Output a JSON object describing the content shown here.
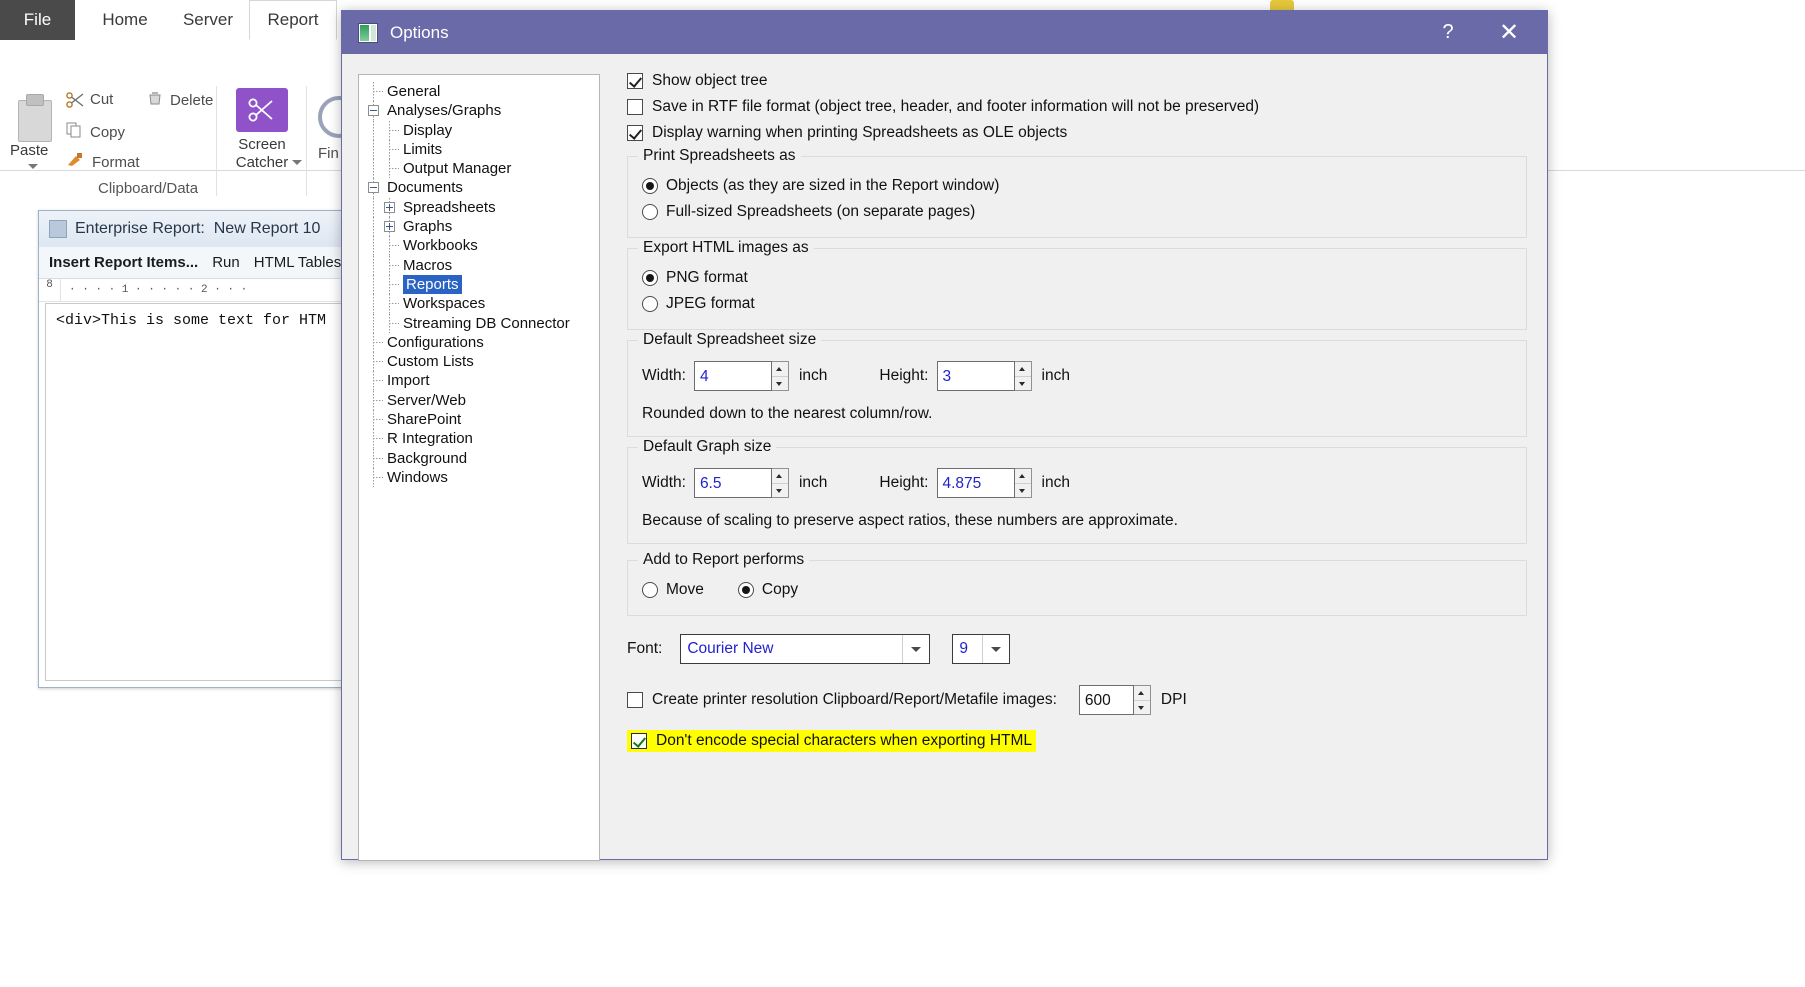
{
  "app": {
    "ribbon": {
      "tabs": [
        {
          "label": "File",
          "active": false
        },
        {
          "label": "Home",
          "active": false
        },
        {
          "label": "Server",
          "active": false
        },
        {
          "label": "Report",
          "active": true
        }
      ],
      "paste_label": "Paste",
      "clipboard_items": [
        "Cut",
        "Copy",
        "Format"
      ],
      "delete_label": "Delete",
      "screen_catcher_label": "Screen\nCatcher",
      "screen_catcher_line1": "Screen",
      "screen_catcher_line2": "Catcher",
      "find_label": "Fin",
      "group_label": "Clipboard/Data"
    },
    "document_window": {
      "title_prefix": "Enterprise Report:",
      "title_name": "New Report 10",
      "toolbar": [
        "Insert Report Items...",
        "Run",
        "HTML Tables"
      ],
      "ruler_marks": "·  ·  ·  ·  1  ·  ·  ·  ·  ·  2  ·  ·  ·",
      "ruler_corner": "8",
      "body_text": "<div>This is some text for HTM"
    }
  },
  "dialog": {
    "title": "Options",
    "icon": "options-window-icon",
    "help_label": "?",
    "close_label": "✕",
    "accent_color": "#6a6aa8",
    "tree": {
      "selected": "Reports",
      "items": [
        {
          "label": "General",
          "depth": 0,
          "expander": "none"
        },
        {
          "label": "Analyses/Graphs",
          "depth": 0,
          "expander": "minus"
        },
        {
          "label": "Display",
          "depth": 1,
          "expander": "none"
        },
        {
          "label": "Limits",
          "depth": 1,
          "expander": "none"
        },
        {
          "label": "Output Manager",
          "depth": 1,
          "expander": "none"
        },
        {
          "label": "Documents",
          "depth": 0,
          "expander": "minus"
        },
        {
          "label": "Spreadsheets",
          "depth": 1,
          "expander": "plus"
        },
        {
          "label": "Graphs",
          "depth": 1,
          "expander": "plus"
        },
        {
          "label": "Workbooks",
          "depth": 1,
          "expander": "none"
        },
        {
          "label": "Macros",
          "depth": 1,
          "expander": "none"
        },
        {
          "label": "Reports",
          "depth": 1,
          "expander": "none"
        },
        {
          "label": "Workspaces",
          "depth": 1,
          "expander": "none"
        },
        {
          "label": "Streaming DB Connector",
          "depth": 1,
          "expander": "none"
        },
        {
          "label": "Configurations",
          "depth": 0,
          "expander": "none"
        },
        {
          "label": "Custom Lists",
          "depth": 0,
          "expander": "none"
        },
        {
          "label": "Import",
          "depth": 0,
          "expander": "none"
        },
        {
          "label": "Server/Web",
          "depth": 0,
          "expander": "none"
        },
        {
          "label": "SharePoint",
          "depth": 0,
          "expander": "none"
        },
        {
          "label": "R Integration",
          "depth": 0,
          "expander": "none"
        },
        {
          "label": "Background",
          "depth": 0,
          "expander": "none"
        },
        {
          "label": "Windows",
          "depth": 0,
          "expander": "none"
        }
      ]
    },
    "options": {
      "show_object_tree": {
        "label": "Show object tree",
        "checked": true
      },
      "save_rtf": {
        "label": "Save in RTF file format (object tree, header, and footer information will not be preserved)",
        "checked": false
      },
      "display_warning": {
        "label": "Display warning when printing Spreadsheets as OLE objects",
        "checked": true
      },
      "print_spreadsheets_as": {
        "title": "Print Spreadsheets as",
        "options": [
          {
            "label": "Objects (as they are sized in the Report window)",
            "selected": true
          },
          {
            "label": "Full-sized Spreadsheets (on separate pages)",
            "selected": false
          }
        ]
      },
      "export_html_images_as": {
        "title": "Export HTML images as",
        "options": [
          {
            "label": "PNG format",
            "selected": true
          },
          {
            "label": "JPEG format",
            "selected": false
          }
        ]
      },
      "default_spreadsheet_size": {
        "title": "Default Spreadsheet size",
        "width_label": "Width:",
        "width_value": "4",
        "width_unit": "inch",
        "height_label": "Height:",
        "height_value": "3",
        "height_unit": "inch",
        "note": "Rounded down to the nearest column/row."
      },
      "default_graph_size": {
        "title": "Default Graph size",
        "width_label": "Width:",
        "width_value": "6.5",
        "width_unit": "inch",
        "height_label": "Height:",
        "height_value": "4.875",
        "height_unit": "inch",
        "note": "Because of scaling to preserve aspect ratios, these numbers are approximate."
      },
      "add_to_report_performs": {
        "title": "Add to Report performs",
        "options": [
          {
            "label": "Move",
            "selected": false
          },
          {
            "label": "Copy",
            "selected": true
          }
        ]
      },
      "font": {
        "label": "Font:",
        "family_value": "Courier New",
        "size_value": "9"
      },
      "printer_resolution": {
        "label": "Create printer resolution Clipboard/Report/Metafile images:",
        "checked": false,
        "dpi_value": "600",
        "dpi_unit": "DPI"
      },
      "dont_encode": {
        "label": "Don't encode special characters when exporting HTML",
        "checked": true,
        "highlight_color": "#ffff00"
      }
    }
  }
}
